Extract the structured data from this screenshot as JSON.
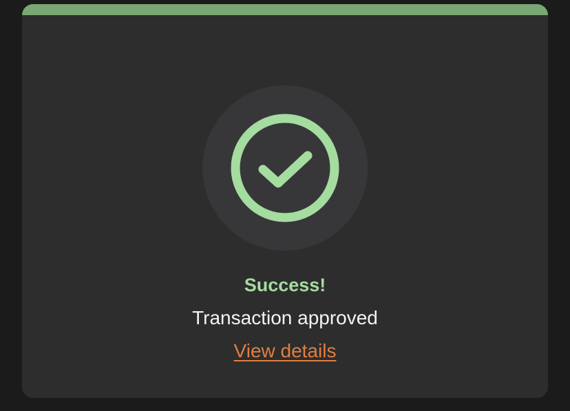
{
  "status": {
    "title": "Success!",
    "message": "Transaction approved",
    "link_label": "View details"
  },
  "icons": {
    "main": "check-circle-icon"
  },
  "colors": {
    "accent_bar": "#7aa874",
    "success": "#a5dc9f",
    "link": "#e07e42",
    "card_bg": "#2d2d2d",
    "page_bg": "#1b1b1b"
  }
}
